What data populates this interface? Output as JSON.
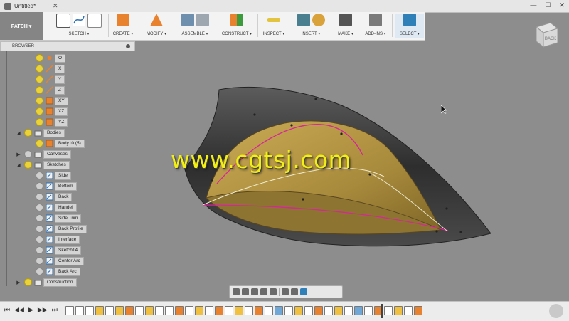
{
  "window": {
    "doc_tab": "Untitled*"
  },
  "toolbar": {
    "workspace": "PATCH ▾",
    "groups": [
      {
        "label": "SKETCH ▾"
      },
      {
        "label": "CREATE ▾"
      },
      {
        "label": "MODIFY ▾"
      },
      {
        "label": "ASSEMBLE ▾"
      },
      {
        "label": "CONSTRUCT ▾"
      },
      {
        "label": "INSPECT ▾"
      },
      {
        "label": "INSERT ▾"
      },
      {
        "label": "MAKE ▾"
      },
      {
        "label": "ADD-INS ▾"
      },
      {
        "label": "SELECT ▾"
      }
    ]
  },
  "viewcube": {
    "face": "BACK"
  },
  "browser": {
    "title": "BROWSER",
    "items": [
      {
        "label": "O",
        "icon": "origin-point-icon"
      },
      {
        "label": "X",
        "icon": "axis-icon"
      },
      {
        "label": "Y",
        "icon": "axis-icon"
      },
      {
        "label": "Z",
        "icon": "axis-icon"
      },
      {
        "label": "XY",
        "icon": "plane-icon"
      },
      {
        "label": "XZ",
        "icon": "plane-icon"
      },
      {
        "label": "YZ",
        "icon": "plane-icon"
      },
      {
        "label": "Bodies",
        "icon": "folder-icon"
      },
      {
        "label": "Body10 (5)",
        "icon": "body-icon"
      },
      {
        "label": "Canvases",
        "icon": "folder-icon"
      },
      {
        "label": "Sketches",
        "icon": "folder-icon"
      },
      {
        "label": "Side",
        "icon": "sketch-icon"
      },
      {
        "label": "Bottom",
        "icon": "sketch-icon"
      },
      {
        "label": "Back",
        "icon": "sketch-icon"
      },
      {
        "label": "Handel",
        "icon": "sketch-icon"
      },
      {
        "label": "Side Trim",
        "icon": "sketch-icon"
      },
      {
        "label": "Back Profile",
        "icon": "sketch-icon"
      },
      {
        "label": "Interface",
        "icon": "sketch-icon"
      },
      {
        "label": "Sketch14",
        "icon": "sketch-icon"
      },
      {
        "label": "Center Arc",
        "icon": "sketch-icon"
      },
      {
        "label": "Back Arc",
        "icon": "sketch-icon"
      },
      {
        "label": "Construction",
        "icon": "folder-icon"
      }
    ]
  },
  "watermark": "www.cgtsj.com",
  "colors": {
    "accent": "#f2ef14",
    "sketch_line": "#d8259b",
    "surface": "#b89a45"
  }
}
